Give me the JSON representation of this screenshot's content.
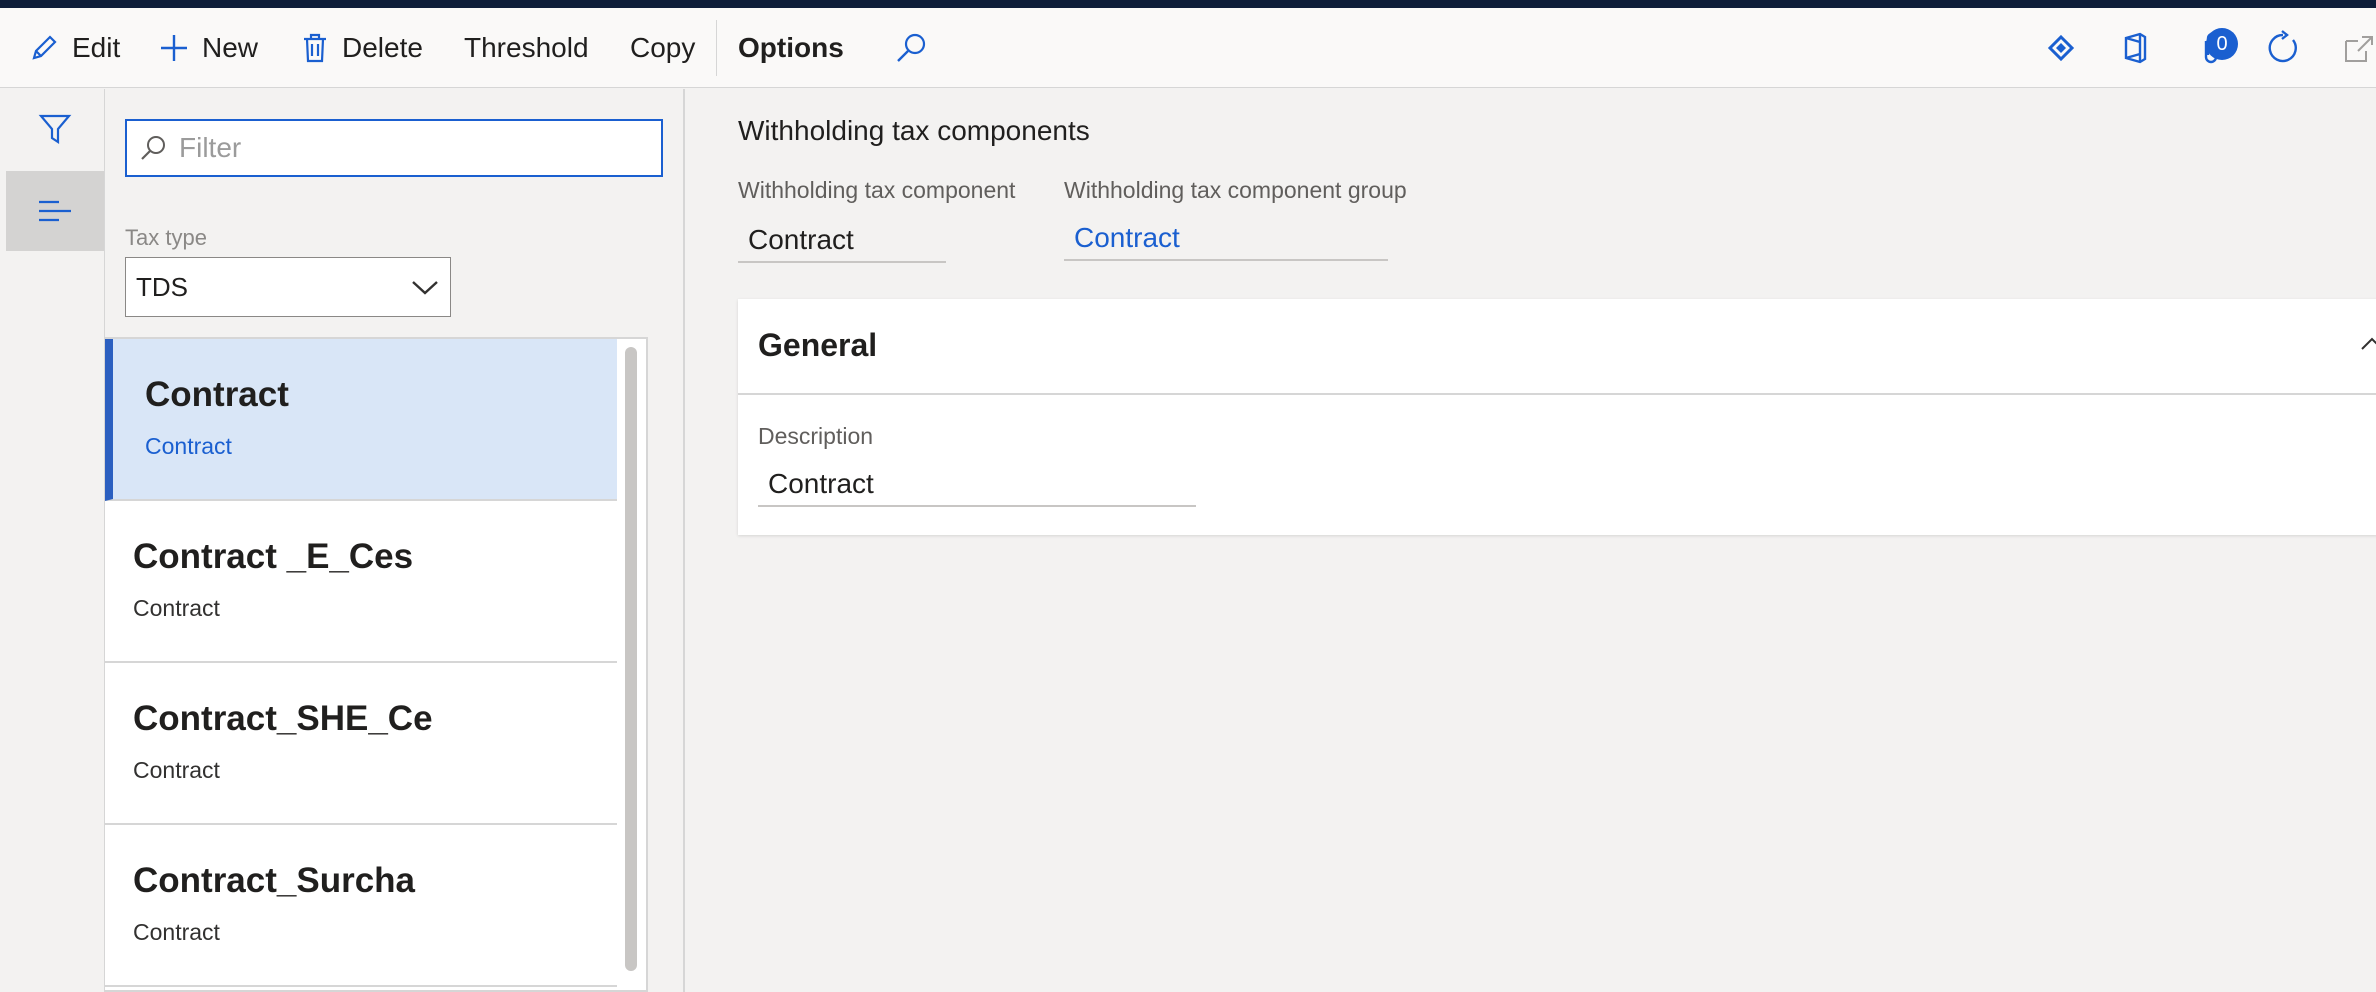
{
  "toolbar": {
    "edit_label": "Edit",
    "new_label": "New",
    "delete_label": "Delete",
    "threshold_label": "Threshold",
    "copy_label": "Copy",
    "options_label": "Options",
    "attachments_count": "0",
    "icons": [
      "edit-icon",
      "plus-icon",
      "trash-icon",
      "search-icon",
      "diamond-icon",
      "office-icon",
      "paperclip-icon",
      "refresh-icon",
      "open-new-window-icon"
    ]
  },
  "list": {
    "filter_placeholder": "Filter",
    "filter_value": "",
    "tax_type_label": "Tax type",
    "tax_type_value": "TDS",
    "items": [
      {
        "title": "Contract",
        "subtitle": "Contract",
        "selected": true
      },
      {
        "title": "Contract _E_Ces",
        "subtitle": "Contract",
        "selected": false
      },
      {
        "title": "Contract_SHE_Ce",
        "subtitle": "Contract",
        "selected": false
      },
      {
        "title": "Contract_Surcha",
        "subtitle": "Contract",
        "selected": false
      }
    ]
  },
  "detail": {
    "section_title": "Withholding tax components",
    "component_label": "Withholding tax component",
    "component_value": "Contract",
    "group_label": "Withholding tax component group",
    "group_value": "Contract",
    "general": {
      "title": "General",
      "description_label": "Description",
      "description_value": "Contract"
    }
  },
  "colors": {
    "accent": "#1a5fd0",
    "selection_bg": "#d9e6f7",
    "top_bar": "#0f1e3a"
  }
}
